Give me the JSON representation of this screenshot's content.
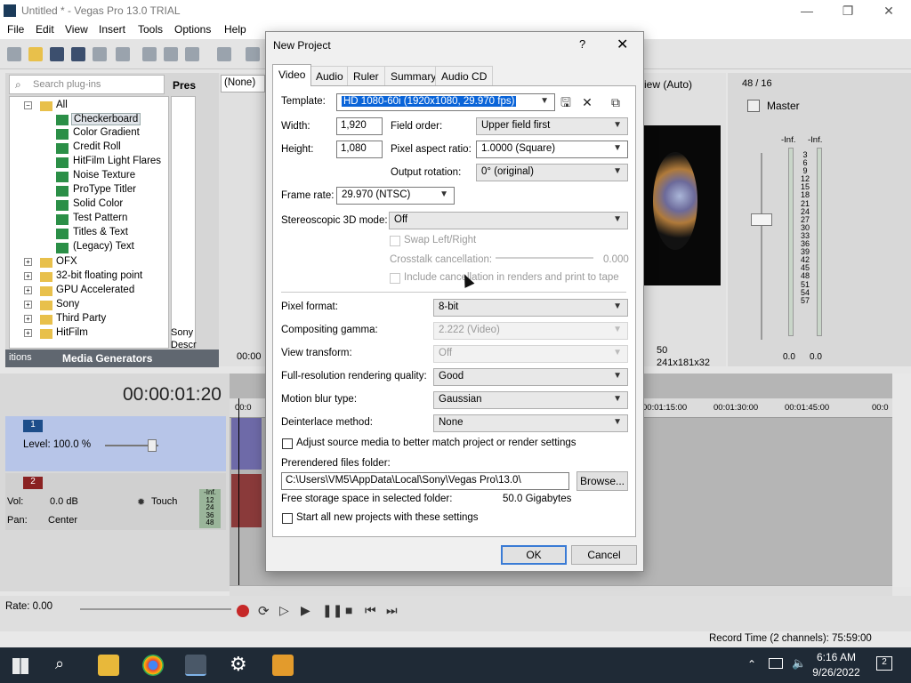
{
  "window": {
    "title": "Untitled * - Vegas Pro 13.0 TRIAL",
    "controls": [
      "—",
      "❐",
      "✕"
    ]
  },
  "menu": [
    "File",
    "Edit",
    "View",
    "Insert",
    "Tools",
    "Options",
    "Help"
  ],
  "plugin_panel": {
    "search_placeholder": "Search plug-ins",
    "presets_label": "Pres",
    "tree": [
      {
        "label": "All",
        "type": "folder",
        "level": 0,
        "expanded": true
      },
      {
        "label": "Checkerboard",
        "type": "plugin",
        "level": 1,
        "selected": true
      },
      {
        "label": "Color Gradient",
        "type": "plugin",
        "level": 1
      },
      {
        "label": "Credit Roll",
        "type": "plugin",
        "level": 1
      },
      {
        "label": "HitFilm Light Flares",
        "type": "plugin",
        "level": 1
      },
      {
        "label": "Noise Texture",
        "type": "plugin",
        "level": 1
      },
      {
        "label": "ProType Titler",
        "type": "plugin",
        "level": 1
      },
      {
        "label": "Solid Color",
        "type": "plugin",
        "level": 1
      },
      {
        "label": "Test Pattern",
        "type": "plugin",
        "level": 1
      },
      {
        "label": "Titles & Text",
        "type": "plugin",
        "level": 1
      },
      {
        "label": "(Legacy) Text",
        "type": "plugin",
        "level": 1
      },
      {
        "label": "OFX",
        "type": "folder",
        "level": 0
      },
      {
        "label": "32-bit floating point",
        "type": "folder",
        "level": 0
      },
      {
        "label": "GPU Accelerated",
        "type": "folder",
        "level": 0
      },
      {
        "label": "Sony",
        "type": "folder",
        "level": 0
      },
      {
        "label": "Third Party",
        "type": "folder",
        "level": 0
      },
      {
        "label": "HitFilm",
        "type": "folder",
        "level": 0
      }
    ],
    "side_text": [
      "Sony",
      "Descr"
    ],
    "tabs": [
      "itions",
      "Media Generators"
    ]
  },
  "preview": {
    "none_label": "(None)",
    "view_auto": "iew (Auto)",
    "frame_info": "50",
    "size_info": "241x181x32",
    "time_small": "00:00"
  },
  "master": {
    "counter": "48 / 16",
    "title": "Master",
    "inf_left": "-Inf.",
    "inf_right": "-Inf.",
    "scale": [
      "3",
      "6",
      "9",
      "12",
      "15",
      "18",
      "21",
      "24",
      "27",
      "30",
      "33",
      "36",
      "39",
      "42",
      "45",
      "48",
      "51",
      "54",
      "57"
    ],
    "bottom_left": "0.0",
    "bottom_right": "0.0"
  },
  "timeline": {
    "timecode": "00:00:01:20",
    "track1": {
      "number": "1",
      "level": "Level: 100.0 %"
    },
    "track2": {
      "number": "2",
      "vol_label": "Vol:",
      "vol_value": "0.0 dB",
      "pan_label": "Pan:",
      "pan_value": "Center",
      "touch": "Touch"
    },
    "track2_meter": [
      "-Inf.",
      "12",
      "24",
      "36",
      "48"
    ],
    "ruler": [
      "00:0",
      "00:01:15:00",
      "00:01:30:00",
      "00:01:45:00",
      "00:0"
    ],
    "rate": "Rate: 0.00"
  },
  "status": {
    "record_time": "Record Time (2 channels): 75:59:00"
  },
  "taskbar": {
    "time": "6:16 AM",
    "date": "9/26/2022",
    "notifications": "2"
  },
  "dialog": {
    "title": "New Project",
    "help": "?",
    "close": "✕",
    "tabs": [
      "Video",
      "Audio",
      "Ruler",
      "Summary",
      "Audio CD"
    ],
    "active_tab": "Video",
    "template_label": "Template:",
    "template_value": "HD 1080-60i (1920x1080, 29.970 fps)",
    "width_label": "Width:",
    "width_value": "1,920",
    "height_label": "Height:",
    "height_value": "1,080",
    "field_order_label": "Field order:",
    "field_order_value": "Upper field first",
    "par_label": "Pixel aspect ratio:",
    "par_value": "1.0000 (Square)",
    "rotation_label": "Output rotation:",
    "rotation_value": "0° (original)",
    "frame_rate_label": "Frame rate:",
    "frame_rate_value": "29.970 (NTSC)",
    "stereo_label": "Stereoscopic 3D mode:",
    "stereo_value": "Off",
    "swap_label": "Swap Left/Right",
    "crosstalk_label": "Crosstalk cancellation:",
    "crosstalk_value": "0.000",
    "include_cancel_label": "Include cancellation in renders and print to tape",
    "pixel_format_label": "Pixel format:",
    "pixel_format_value": "8-bit",
    "gamma_label": "Compositing gamma:",
    "gamma_value": "2.222 (Video)",
    "view_transform_label": "View transform:",
    "view_transform_value": "Off",
    "render_quality_label": "Full-resolution rendering quality:",
    "render_quality_value": "Good",
    "motion_blur_label": "Motion blur type:",
    "motion_blur_value": "Gaussian",
    "deinterlace_label": "Deinterlace method:",
    "deinterlace_value": "None",
    "adjust_source_label": "Adjust source media to better match project or render settings",
    "prerendered_label": "Prerendered files folder:",
    "prerendered_value": "C:\\Users\\VM5\\AppData\\Local\\Sony\\Vegas Pro\\13.0\\",
    "browse_label": "Browse...",
    "free_space_label": "Free storage space in selected folder:",
    "free_space_value": "50.0 Gigabytes",
    "start_all_label": "Start all new projects with these settings",
    "ok_label": "OK",
    "cancel_label": "Cancel"
  },
  "colors": {
    "accent": "#3a7bd5",
    "selection": "#0a64d8",
    "track1": "#b7c5e8",
    "taskbar": "#1f2a36"
  }
}
